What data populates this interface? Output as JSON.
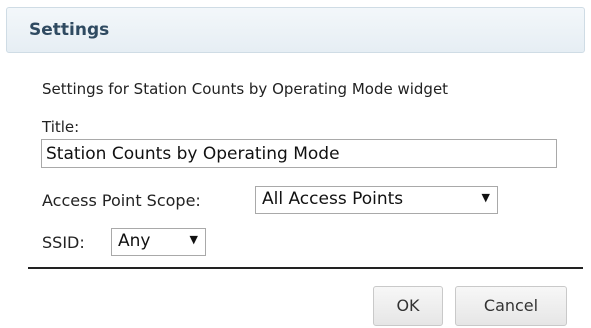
{
  "dialog": {
    "header_title": "Settings",
    "description": "Settings for Station Counts by Operating Mode widget",
    "title_label": "Title:",
    "title_value": "Station Counts by Operating Mode",
    "scope_label": "Access Point Scope:",
    "scope_value": "All Access Points",
    "ssid_label": "SSID:",
    "ssid_value": "Any",
    "dropdown_arrow": "▼",
    "ok_label": "OK",
    "cancel_label": "Cancel"
  },
  "colors": {
    "header_text": "#2f4a61",
    "header_border": "#cfdce5",
    "divider": "#222222"
  }
}
